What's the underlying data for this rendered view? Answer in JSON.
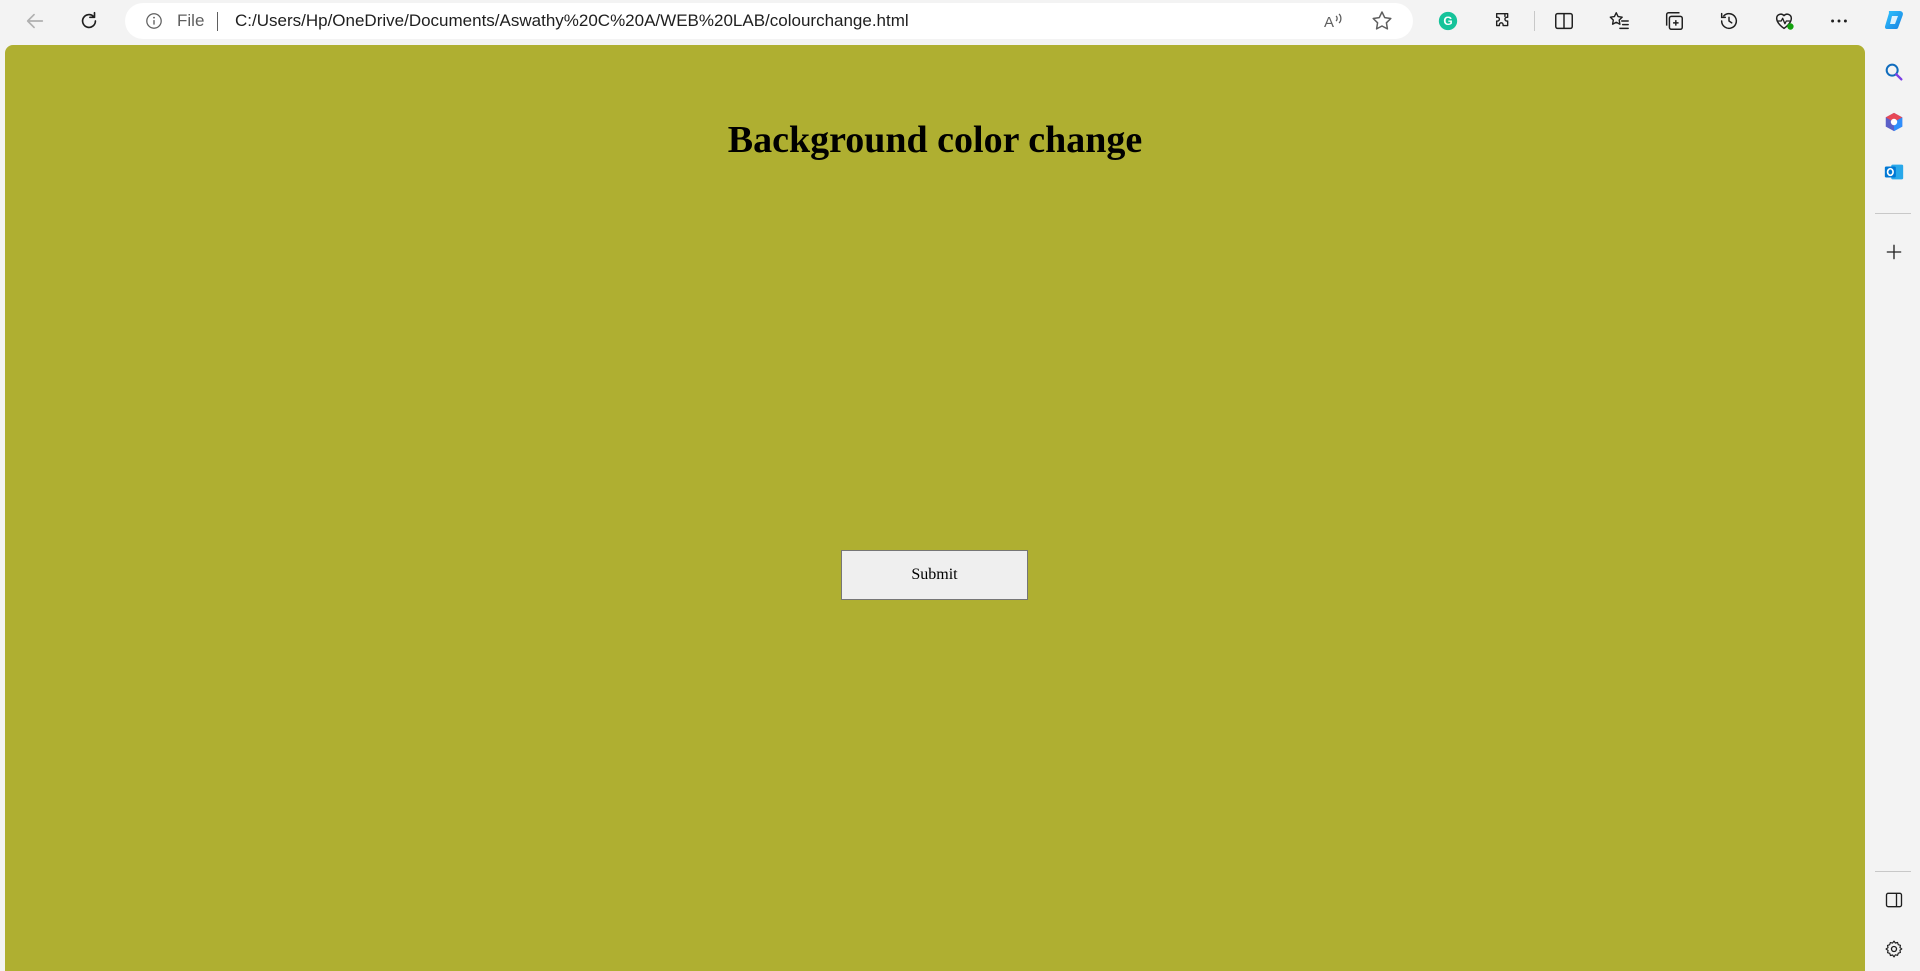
{
  "browser": {
    "address_bar": {
      "scheme_label": "File",
      "url": "C:/Users/Hp/OneDrive/Documents/Aswathy%20C%20A/WEB%20LAB/colourchange.html"
    },
    "toolbar_icons": [
      "back-icon",
      "refresh-icon",
      "info-icon",
      "read-aloud-icon",
      "favorite-star-icon",
      "grammarly-icon",
      "extensions-icon",
      "split-screen-icon",
      "favorites-icon",
      "collections-icon",
      "history-icon",
      "browser-essentials-icon",
      "more-icon",
      "copilot-icon"
    ],
    "sidebar_icons": [
      "search-icon",
      "office-icon",
      "outlook-icon",
      "add-icon",
      "hide-sidebar-icon",
      "settings-icon"
    ]
  },
  "page": {
    "heading": "Background color change",
    "submit_label": "Submit",
    "background_color": "#afaf31"
  }
}
